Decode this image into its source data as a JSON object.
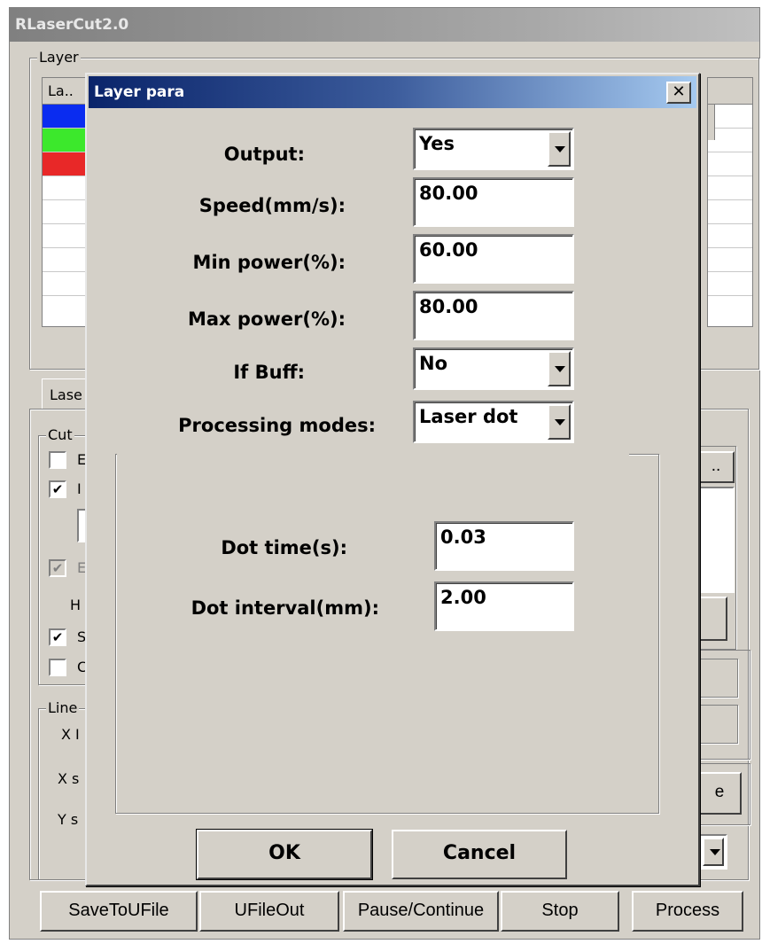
{
  "main_window": {
    "title": "RLaserCut2.0",
    "layer_group_label": "Layer",
    "layer_list_header": "La..",
    "layer_colors": [
      "#0a2cf0",
      "#3ce82c",
      "#e82828"
    ],
    "laser_tab_fragment": "Lase",
    "cut_group_fragment": "Cut",
    "checkbox_fragments": [
      "E",
      "I",
      "E",
      "H",
      "S",
      "C"
    ],
    "line_group_fragment": "Line",
    "line_fragments": [
      "X I",
      "X s",
      "Y s"
    ],
    "right_button_fragment": "..",
    "right_button2_fragment": "e"
  },
  "dialog": {
    "title": "Layer para",
    "close_glyph": "✕",
    "output": {
      "label": "Output:",
      "value": "Yes"
    },
    "speed": {
      "label": "Speed(mm/s):",
      "value": "80.00"
    },
    "min_power": {
      "label": "Min power(%):",
      "value": "60.00"
    },
    "max_power": {
      "label": "Max power(%):",
      "value": "80.00"
    },
    "if_buff": {
      "label": "If Buff:",
      "value": "No"
    },
    "processing_mode": {
      "label": "Processing modes:",
      "value": "Laser dot"
    },
    "dot_time": {
      "label": "Dot time(s):",
      "value": "0.03"
    },
    "dot_interval": {
      "label": "Dot interval(mm):",
      "value": "2.00"
    },
    "ok_label": "OK",
    "cancel_label": "Cancel"
  },
  "bottom_bar": {
    "save_to_ufile": "SaveToUFile",
    "ufile_out": "UFileOut",
    "pause_continue": "Pause/Continue",
    "stop": "Stop",
    "process": "Process"
  }
}
